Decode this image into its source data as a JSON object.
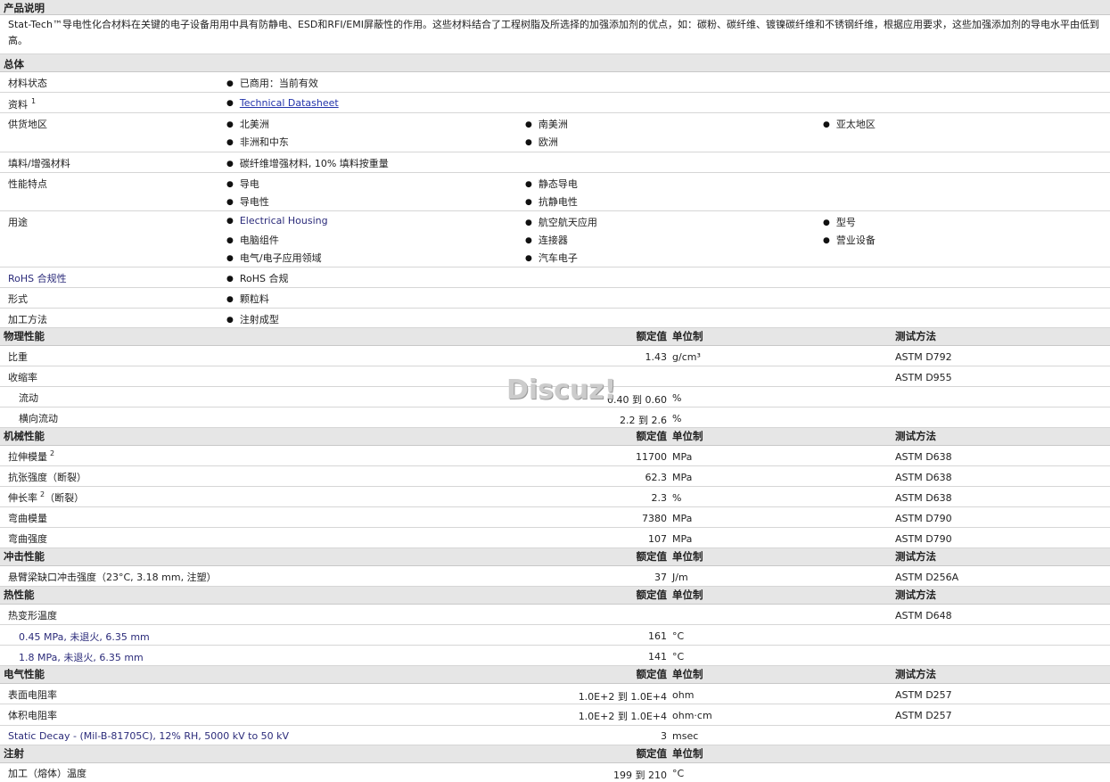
{
  "sections": {
    "product_desc": "产品说明",
    "general": "总体",
    "physical": "物理性能",
    "mechanical": "机械性能",
    "impact": "冲击性能",
    "thermal": "热性能",
    "electrical": "电气性能",
    "injection": "注射"
  },
  "column_headers": {
    "value": "额定值",
    "unit": "单位制",
    "test": "测试方法"
  },
  "description": "Stat-Tech™导电性化合材料在关键的电子设备用用中具有防静电、ESD和RFI/EMI屏蔽性的作用。这些材料结合了工程树脂及所选择的加强添加剂的优点，如：碳粉、碳纤维、镀镍碳纤维和不锈钢纤维，根据应用要求，这些加强添加剂的导电水平由低到高。",
  "general": {
    "material_status_label": "材料状态",
    "material_status": "已商用：当前有效",
    "info_label": "资料",
    "info_sup": "1",
    "info_link": "Technical Datasheet",
    "region_label": "供货地区",
    "regions": [
      "北美洲",
      "南美洲",
      "亚太地区",
      "非洲和中东",
      "欧洲"
    ],
    "filler_label": "填料/增强材料",
    "filler": "碳纤维增强材料, 10% 填料按重量",
    "features_label": "性能特点",
    "features": [
      "导电",
      "静态导电",
      "导电性",
      "抗静电性"
    ],
    "uses_label": "用途",
    "uses": [
      "Electrical Housing",
      "航空航天应用",
      "型号",
      "电脑组件",
      "连接器",
      "营业设备",
      "电气/电子应用领域",
      "汽车电子"
    ],
    "rohs_label": "RoHS 合规性",
    "rohs": "RoHS 合规",
    "form_label": "形式",
    "form": "颗粒料",
    "process_label": "加工方法",
    "process": "注射成型"
  },
  "physical": {
    "sg_label": "比重",
    "sg_value": "1.43",
    "sg_unit": "g/cm³",
    "sg_test": "ASTM D792",
    "shrink_label": "收缩率",
    "shrink_test": "ASTM D955",
    "flow_label": "流动",
    "flow_value": "0.40 到  0.60",
    "flow_unit": "%",
    "cross_label": "横向流动",
    "cross_value": "2.2 到  2.6",
    "cross_unit": "%"
  },
  "mechanical": [
    {
      "label": "拉伸模量",
      "sup": "2",
      "value": "11700",
      "unit": "MPa",
      "test": "ASTM D638"
    },
    {
      "label": "抗张强度（断裂）",
      "sup": "",
      "value": "62.3",
      "unit": "MPa",
      "test": "ASTM D638"
    },
    {
      "label": "伸长率",
      "sup": "2",
      "suffix": "（断裂）",
      "value": "2.3",
      "unit": "%",
      "test": "ASTM D638"
    },
    {
      "label": "弯曲模量",
      "sup": "",
      "value": "7380",
      "unit": "MPa",
      "test": "ASTM D790"
    },
    {
      "label": "弯曲强度",
      "sup": "",
      "value": "107",
      "unit": "MPa",
      "test": "ASTM D790"
    }
  ],
  "impact": {
    "label": "悬臂梁缺口冲击强度（23°C, 3.18 mm, 注塑）",
    "value": "37",
    "unit": "J/m",
    "test": "ASTM D256A"
  },
  "thermal": {
    "hdt_label": "热变形温度",
    "hdt_test": "ASTM D648",
    "r1_label": "0.45 MPa, 未退火, 6.35 mm",
    "r1_value": "161",
    "r1_unit": "°C",
    "r2_label": "1.8 MPa, 未退火, 6.35 mm",
    "r2_value": "141",
    "r2_unit": "°C"
  },
  "electrical": {
    "surf_label": "表面电阻率",
    "surf_value": "1.0E+2 到  1.0E+4",
    "surf_unit": "ohm",
    "surf_test": "ASTM D257",
    "vol_label": "体积电阻率",
    "vol_value": "1.0E+2 到  1.0E+4",
    "vol_unit": "ohm·cm",
    "vol_test": "ASTM D257",
    "decay_label": "Static Decay - (Mil-B-81705C), 12% RH, 5000 kV to 50 kV",
    "decay_value": "3",
    "decay_unit": "msec"
  },
  "injection": {
    "melt_label": "加工（熔体）温度",
    "melt_value": "199 到  210",
    "melt_unit": "°C"
  },
  "watermark": "Discuz!"
}
